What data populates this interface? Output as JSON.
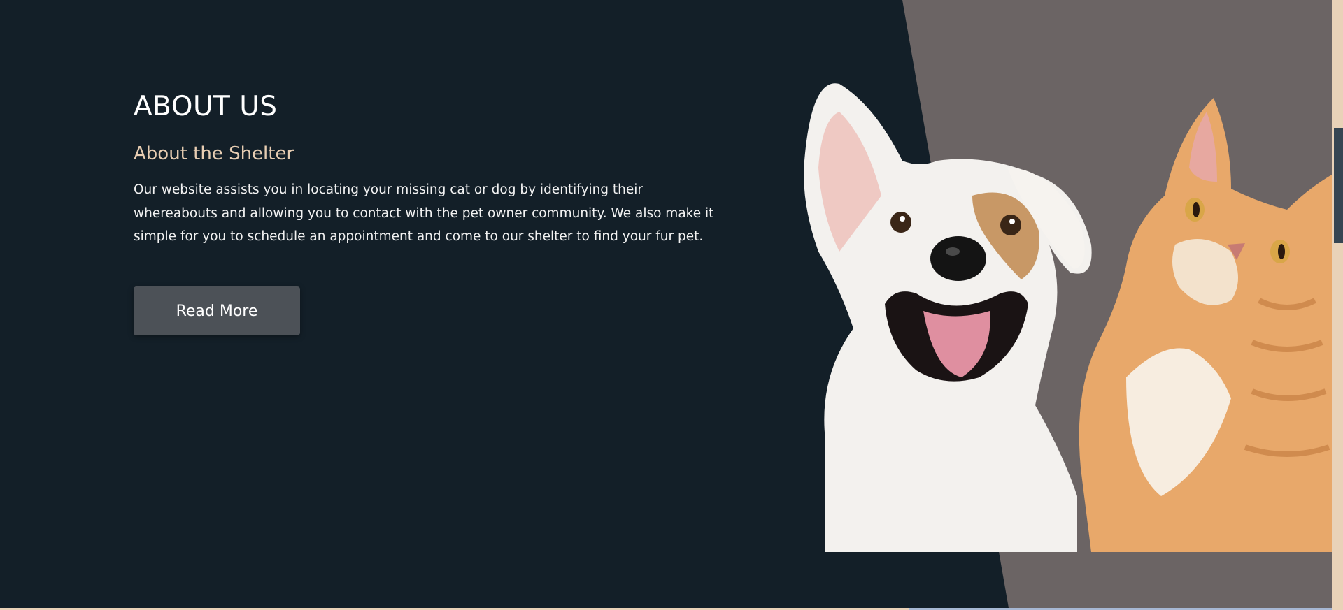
{
  "about": {
    "title": "ABOUT US",
    "subtitle": "About the Shelter",
    "description": "Our website assists you in locating your missing cat or dog by identifying their whereabouts and allowing you to contact with the pet owner community. We also make it simple for you to schedule an appointment and come to our shelter to find your fur pet.",
    "button_label": "Read More"
  },
  "image": {
    "subject": "dog-and-cat"
  },
  "colors": {
    "background": "#131f28",
    "panel": "#6b6464",
    "accent": "#e7cdb2",
    "button": "#4c5157"
  }
}
